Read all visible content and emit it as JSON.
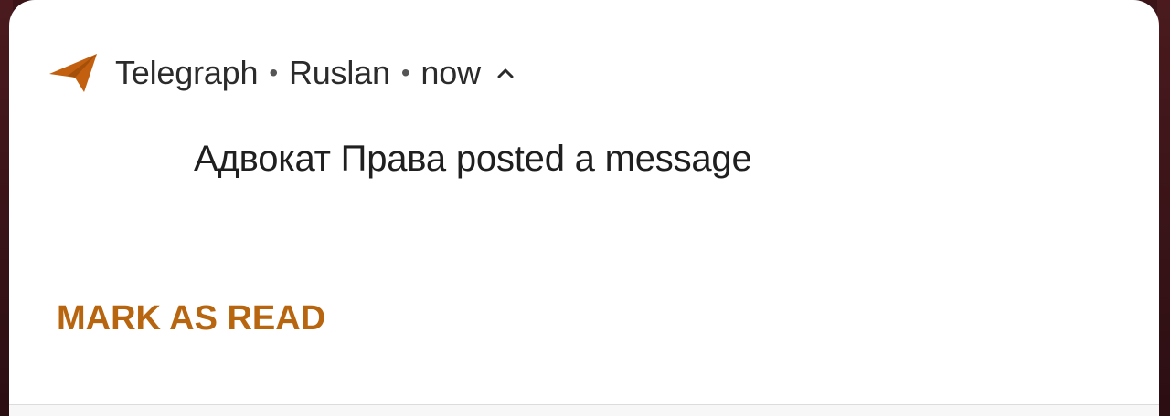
{
  "notification": {
    "app_name": "Telegraph",
    "separator": "•",
    "account": "Ruslan",
    "time": "now",
    "expand_icon": "chevron-up-icon",
    "app_icon": "paper-plane-icon",
    "message": "Адвокат Права posted a message",
    "action_label": "MARK AS READ"
  },
  "colors": {
    "accent": "#b8650f",
    "icon": "#c2600f",
    "text": "#1f1f1f",
    "card_bg": "#ffffff",
    "background": "#2a0d10"
  }
}
